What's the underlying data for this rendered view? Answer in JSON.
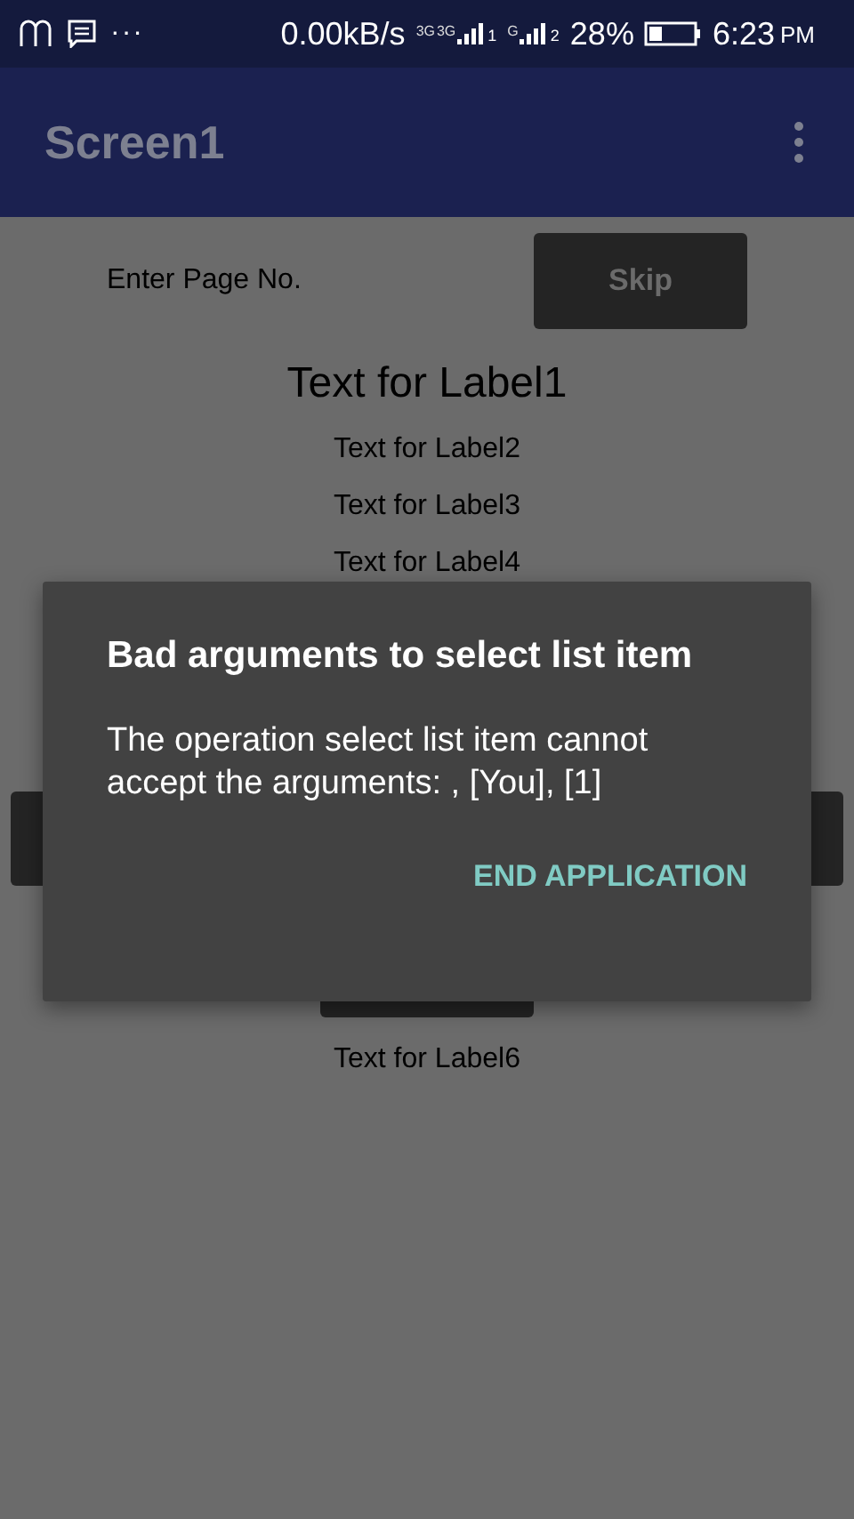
{
  "status_bar": {
    "speed": "0.00kB/s",
    "sim1_network": "3G",
    "sim1_data": "3G",
    "sim1_index": "1",
    "sim2_network": "G",
    "sim2_index": "2",
    "battery": "28%",
    "time": "6:23",
    "ampm": "PM",
    "more": "···"
  },
  "app_bar": {
    "title": "Screen1"
  },
  "page_row": {
    "label": "Enter Page No.",
    "button": "Skip"
  },
  "labels": [
    {
      "text": "Text for Label1",
      "kind": "large"
    },
    {
      "text": "Text for Label2",
      "kind": "normal"
    },
    {
      "text": "Text for Label3",
      "kind": "normal"
    },
    {
      "text": "Text for Label4",
      "kind": "normal"
    }
  ],
  "covered": [
    {
      "kind": "wide-button"
    },
    {
      "kind": "small-button"
    }
  ],
  "bottom_label": "Text for Label6",
  "dialog": {
    "title": "Bad arguments to select list item",
    "message": "The operation select list item cannot accept the arguments: , [You], [1]",
    "action": "END APPLICATION"
  }
}
